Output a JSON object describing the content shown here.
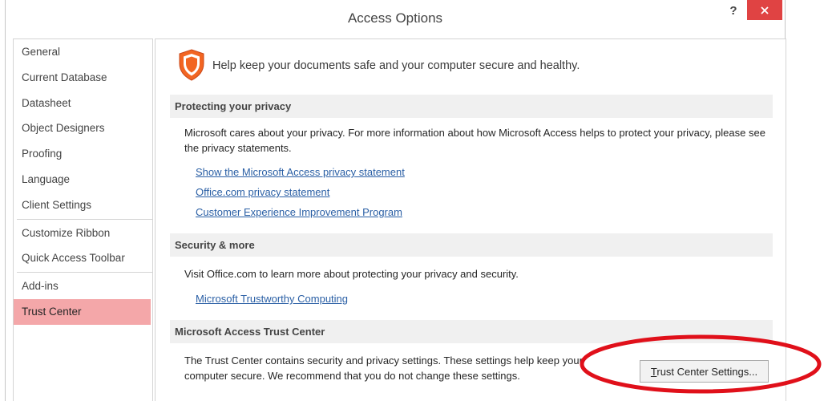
{
  "window": {
    "title": "Access Options",
    "help_label": "?",
    "close_icon": "close-icon"
  },
  "sidebar": {
    "items": [
      {
        "label": "General"
      },
      {
        "label": "Current Database"
      },
      {
        "label": "Datasheet"
      },
      {
        "label": "Object Designers"
      },
      {
        "label": "Proofing"
      },
      {
        "label": "Language"
      },
      {
        "label": "Client Settings"
      },
      {
        "label": "Customize Ribbon"
      },
      {
        "label": "Quick Access Toolbar"
      },
      {
        "label": "Add-ins"
      },
      {
        "label": "Trust Center"
      }
    ],
    "selected": "Trust Center",
    "selected_color": "#f4a7a9"
  },
  "main": {
    "hero_icon": "shield-icon",
    "hero_text": "Help keep your documents safe and your computer secure and healthy.",
    "privacy": {
      "header": "Protecting your privacy",
      "text": "Microsoft cares about your privacy. For more information about how Microsoft Access helps to protect your privacy, please see the privacy statements.",
      "links": [
        "Show the Microsoft Access privacy statement",
        "Office.com privacy statement",
        "Customer Experience Improvement Program"
      ]
    },
    "security": {
      "header": "Security & more",
      "text": "Visit Office.com to learn more about protecting your privacy and security.",
      "link": "Microsoft Trustworthy Computing"
    },
    "trust_center": {
      "header": "Microsoft Access Trust Center",
      "text": "The Trust Center contains security and privacy settings. These settings help keep your computer secure. We recommend that you do not change these settings.",
      "button_label_first": "T",
      "button_label_rest": "rust Center Settings..."
    }
  },
  "colors": {
    "accent_link": "#2a5fa5",
    "close_button": "#e04343",
    "annotation_ellipse": "#e0101a",
    "shield": "#f26522"
  }
}
